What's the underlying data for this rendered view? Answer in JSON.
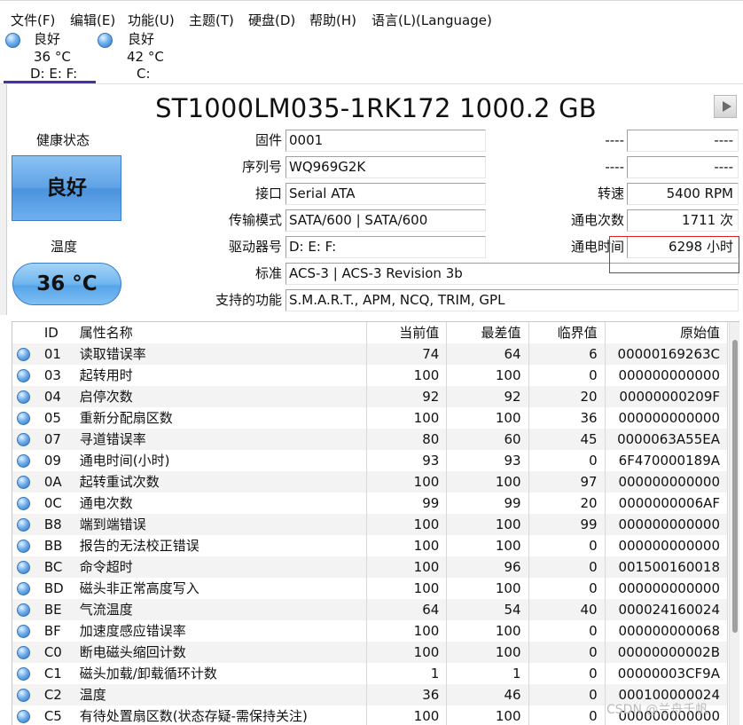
{
  "menu": [
    "文件(F)",
    "编辑(E)",
    "功能(U)",
    "主题(T)",
    "硬盘(D)",
    "帮助(H)",
    "语言(L)(Language)"
  ],
  "drives": [
    {
      "status": "良好",
      "temp": "36 °C",
      "letters": "D: E: F:"
    },
    {
      "status": "良好",
      "temp": "42 °C",
      "letters": "C:"
    }
  ],
  "title": "ST1000LM035-1RK172 1000.2 GB",
  "health": {
    "label": "健康状态",
    "value": "良好"
  },
  "temperature": {
    "label": "温度",
    "value": "36 °C"
  },
  "info": {
    "firmware_label": "固件",
    "firmware": "0001",
    "serial_label": "序列号",
    "serial": "WQ969G2K",
    "interface_label": "接口",
    "interface": "Serial ATA",
    "transfer_label": "传输模式",
    "transfer": "SATA/600 | SATA/600",
    "drive_label": "驱动器号",
    "drive": "D: E: F:",
    "standard_label": "标准",
    "standard": "ACS-3 | ACS-3 Revision 3b",
    "features_label": "支持的功能",
    "features": "S.M.A.R.T., APM, NCQ, TRIM, GPL",
    "blank1_label": "----",
    "blank1": "----",
    "blank2_label": "----",
    "blank2": "----",
    "rpm_label": "转速",
    "rpm": "5400 RPM",
    "power_count_label": "通电次数",
    "power_count": "1711 次",
    "power_hours_label": "通电时间",
    "power_hours": "6298 小时"
  },
  "table": {
    "headers": [
      "ID",
      "属性名称",
      "当前值",
      "最差值",
      "临界值",
      "原始值"
    ],
    "rows": [
      [
        "01",
        "读取错误率",
        "74",
        "64",
        "6",
        "00000169263C"
      ],
      [
        "03",
        "起转用时",
        "100",
        "100",
        "0",
        "000000000000"
      ],
      [
        "04",
        "启停次数",
        "92",
        "92",
        "20",
        "00000000209F"
      ],
      [
        "05",
        "重新分配扇区数",
        "100",
        "100",
        "36",
        "000000000000"
      ],
      [
        "07",
        "寻道错误率",
        "80",
        "60",
        "45",
        "0000063A55EA"
      ],
      [
        "09",
        "通电时间(小时)",
        "93",
        "93",
        "0",
        "6F470000189A"
      ],
      [
        "0A",
        "起转重试次数",
        "100",
        "100",
        "97",
        "000000000000"
      ],
      [
        "0C",
        "通电次数",
        "99",
        "99",
        "20",
        "0000000006AF"
      ],
      [
        "B8",
        "端到端错误",
        "100",
        "100",
        "99",
        "000000000000"
      ],
      [
        "BB",
        "报告的无法校正错误",
        "100",
        "100",
        "0",
        "000000000000"
      ],
      [
        "BC",
        "命令超时",
        "100",
        "96",
        "0",
        "001500160018"
      ],
      [
        "BD",
        "磁头非正常高度写入",
        "100",
        "100",
        "0",
        "000000000000"
      ],
      [
        "BE",
        "气流温度",
        "64",
        "54",
        "40",
        "000024160024"
      ],
      [
        "BF",
        "加速度感应错误率",
        "100",
        "100",
        "0",
        "000000000068"
      ],
      [
        "C0",
        "断电磁头缩回计数",
        "100",
        "100",
        "0",
        "00000000002B"
      ],
      [
        "C1",
        "磁头加载/卸载循环计数",
        "1",
        "1",
        "0",
        "00000003CF9A"
      ],
      [
        "C2",
        "温度",
        "36",
        "46",
        "0",
        "000100000024"
      ],
      [
        "C5",
        "有待处置扇区数(状态存疑-需保持关注)",
        "100",
        "100",
        "0",
        "000000000000"
      ]
    ]
  },
  "watermark": "CSDN @兰舟千帆",
  "colors": {
    "accent": "#4b2fa8",
    "status_blue": "#5fa3e6",
    "highlight_red": "#e02020"
  },
  "icons": {
    "drive_status": "blue-orb-icon",
    "play": "play-icon"
  }
}
